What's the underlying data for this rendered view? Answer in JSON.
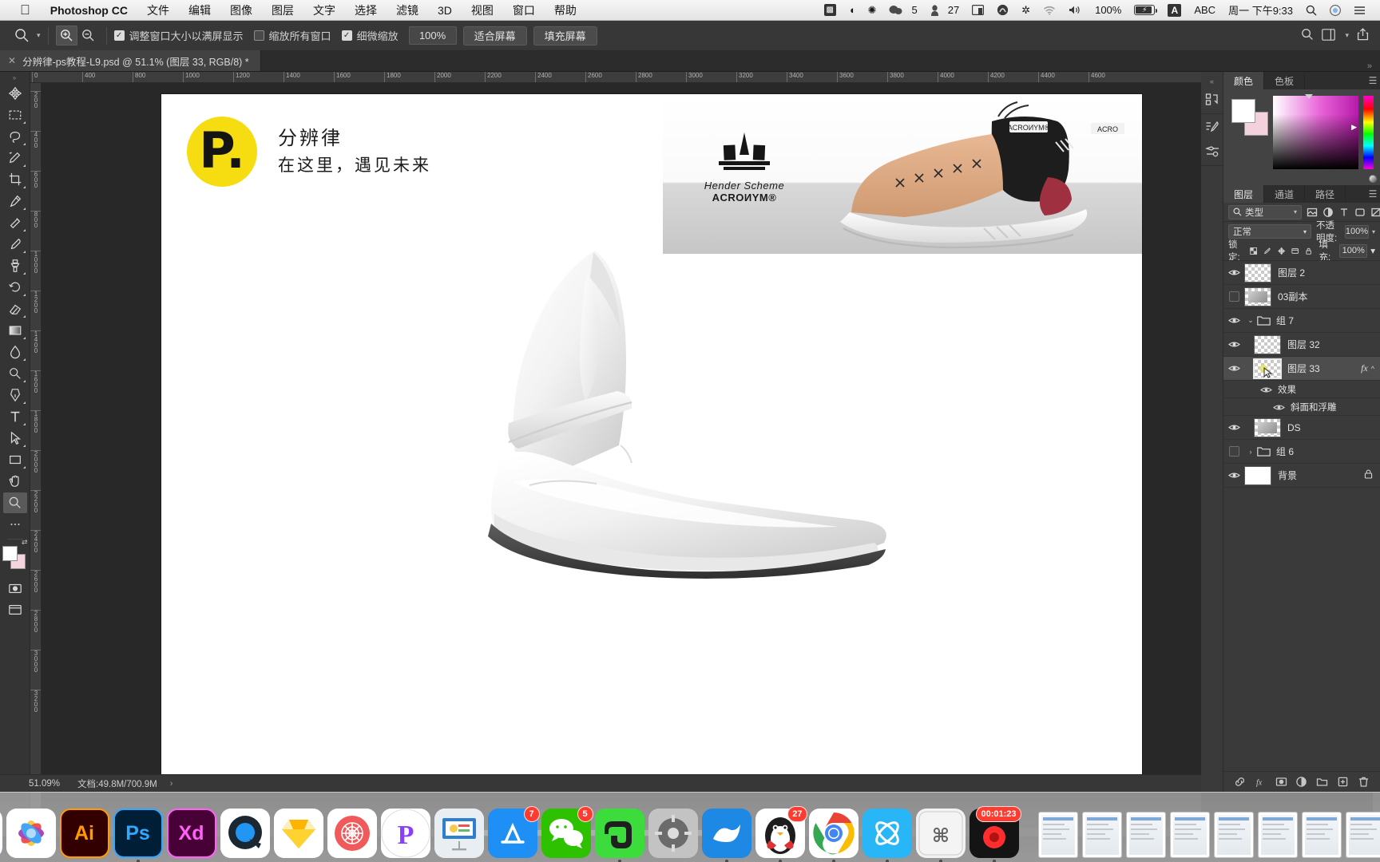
{
  "menubar": {
    "apple_icon": "apple-logo",
    "app_name": "Photoshop CC",
    "items": [
      "文件",
      "编辑",
      "图像",
      "图层",
      "文字",
      "选择",
      "滤镜",
      "3D",
      "视图",
      "窗口",
      "帮助"
    ],
    "status_items": [
      {
        "name": "screenshot-icon",
        "glyph": "▩"
      },
      {
        "name": "nightshift-icon",
        "glyph": "◗"
      },
      {
        "name": "dropbox-icon",
        "glyph": "✼"
      },
      {
        "name": "chat-icon",
        "glyph": "💬",
        "value": "5"
      },
      {
        "name": "user-icon",
        "glyph": "♟",
        "value": "27"
      },
      {
        "name": "display-icon",
        "glyph": "🖵"
      },
      {
        "name": "creativecloud-icon",
        "glyph": "◎"
      },
      {
        "name": "bluetooth-icon",
        "glyph": "✲"
      },
      {
        "name": "wifi-icon",
        "glyph": "◗"
      },
      {
        "name": "volume-icon",
        "glyph": "◀"
      }
    ],
    "battery_percent": "100%",
    "input_source_flag": "A",
    "input_source": "ABC",
    "clock": "周一 下午9:33",
    "spotlight_icon": "search-icon",
    "siri_icon": "siri-icon",
    "controlcenter_icon": "list-icon"
  },
  "optionsbar": {
    "tool_icon": "zoom-tool-icon",
    "zoom_in_icon": "zoom-in-icon",
    "zoom_out_icon": "zoom-out-icon",
    "checkboxes": [
      {
        "label": "调整窗口大小以满屏显示",
        "checked": true
      },
      {
        "label": "缩放所有窗口",
        "checked": false
      },
      {
        "label": "细微缩放",
        "checked": true
      }
    ],
    "zoom_value": "100%",
    "buttons": [
      "适合屏幕",
      "填充屏幕"
    ],
    "right_icons": [
      "search-icon",
      "workspace-icon",
      "share-icon"
    ]
  },
  "tabbar": {
    "close_icon": "close-icon",
    "title": "分辨律-ps教程-L9.psd @ 51.1% (图层 33, RGB/8) *"
  },
  "toolbar": {
    "overflow_icon": "double-chevron-icon",
    "tools": [
      {
        "name": "move-tool",
        "glyph": "move"
      },
      {
        "name": "marquee-tool",
        "glyph": "marquee"
      },
      {
        "name": "lasso-tool",
        "glyph": "lasso"
      },
      {
        "name": "quick-select-tool",
        "glyph": "wand"
      },
      {
        "name": "crop-tool",
        "glyph": "crop"
      },
      {
        "name": "eyedropper-tool",
        "glyph": "eyedropper"
      },
      {
        "name": "healing-brush-tool",
        "glyph": "heal"
      },
      {
        "name": "brush-tool",
        "glyph": "brush"
      },
      {
        "name": "clone-stamp-tool",
        "glyph": "stamp"
      },
      {
        "name": "history-brush-tool",
        "glyph": "history"
      },
      {
        "name": "eraser-tool",
        "glyph": "eraser"
      },
      {
        "name": "gradient-tool",
        "glyph": "gradient"
      },
      {
        "name": "blur-tool",
        "glyph": "blur"
      },
      {
        "name": "dodge-tool",
        "glyph": "dodge"
      },
      {
        "name": "pen-tool",
        "glyph": "pen"
      },
      {
        "name": "type-tool",
        "glyph": "T"
      },
      {
        "name": "path-select-tool",
        "glyph": "arrow"
      },
      {
        "name": "rectangle-tool",
        "glyph": "rect"
      },
      {
        "name": "hand-tool",
        "glyph": "hand"
      },
      {
        "name": "zoom-tool",
        "glyph": "zoom",
        "selected": true
      },
      {
        "name": "more-tools",
        "glyph": "dots"
      }
    ],
    "foreground_color": "#ffffff",
    "background_color": "#f4d5de",
    "quickmask_icon": "quick-mask-icon",
    "screenmode_icon": "screen-mode-icon"
  },
  "rulers": {
    "horizontal_ticks": [
      "0",
      "400",
      "800",
      "1000",
      "1200",
      "1400",
      "1600",
      "1800",
      "2000",
      "2200",
      "2400",
      "2600",
      "2800",
      "3000",
      "3200",
      "3400",
      "3600",
      "3800",
      "4000",
      "4200",
      "4400",
      "4600"
    ],
    "vertical_ticks": [
      "200",
      "400",
      "600",
      "800",
      "1000",
      "1200",
      "1400",
      "1600",
      "1800",
      "2000",
      "2200",
      "2400",
      "2600",
      "2800",
      "3000",
      "3200"
    ]
  },
  "canvas": {
    "logo_letter": "P.",
    "logo_color": "#f5dd12",
    "headline": "分辨律",
    "subline": "在这里，遇见未来",
    "banner": {
      "brand_top": "Hender Scheme",
      "brand_bottom": "ACROИYM®",
      "shoe_tag_1": "ACROИYM®",
      "shoe_tag_2": "ACRO"
    }
  },
  "statusbar": {
    "zoom": "51.09%",
    "doc_label": "文档:49.8M/700.9M",
    "arrow_icon": "chevron-right-icon"
  },
  "rightpanel": {
    "rail_icons": [
      "history-panel-icon",
      "actions-panel-icon",
      "adjustments-panel-icon"
    ],
    "collapse_icon": "double-chevron-icon",
    "color_tabs": [
      {
        "label": "颜色",
        "active": true
      },
      {
        "label": "色板",
        "active": false
      }
    ],
    "layer_tabs": [
      {
        "label": "图层",
        "active": true
      },
      {
        "label": "通道",
        "active": false
      },
      {
        "label": "路径",
        "active": false
      }
    ],
    "panel_menu_icon": "hamburger-icon",
    "filter": {
      "search_icon": "search-icon",
      "type_label": "类型",
      "caret_icon": "chevron-down-icon",
      "kind_icons": [
        "pixel-icon",
        "adjustment-icon",
        "type-icon",
        "shape-icon",
        "smart-icon"
      ],
      "toggle_on": false
    },
    "blend": {
      "mode": "正常",
      "opacity_label": "不透明度:",
      "opacity_value": "100%"
    },
    "lock": {
      "label": "锁定:",
      "icons": [
        "transparency-lock-icon",
        "brush-lock-icon",
        "move-lock-icon",
        "artboard-lock-icon",
        "all-lock-icon"
      ],
      "fill_label": "填充:",
      "fill_value": "100%"
    },
    "layers": [
      {
        "name": "图层 2",
        "visible": true,
        "type": "layer",
        "indent": 0,
        "thumb": "transparent"
      },
      {
        "name": "03副本",
        "visible": false,
        "type": "layer",
        "indent": 0,
        "thumb": "image"
      },
      {
        "name": "组 7",
        "visible": true,
        "type": "group",
        "indent": 0,
        "expanded": true
      },
      {
        "name": "图层 32",
        "visible": true,
        "type": "layer",
        "indent": 1,
        "thumb": "transparent"
      },
      {
        "name": "图层 33",
        "visible": true,
        "type": "layer",
        "indent": 1,
        "thumb": "transparent",
        "selected": true,
        "fx": "fx",
        "fx_caret": "^"
      },
      {
        "name": "效果",
        "visible": true,
        "type": "effects",
        "indent": 2
      },
      {
        "name": "斜面和浮雕",
        "visible": true,
        "type": "effect",
        "indent": 3
      },
      {
        "name": "DS",
        "visible": true,
        "type": "layer",
        "indent": 1,
        "thumb": "image"
      },
      {
        "name": "组 6",
        "visible": false,
        "type": "group",
        "indent": 0,
        "expanded": false
      },
      {
        "name": "背景",
        "visible": true,
        "type": "layer",
        "indent": 0,
        "thumb": "white",
        "locked": true,
        "lock_icon": "lock-icon"
      }
    ],
    "footer_icons": [
      "link-icon",
      "fx-icon",
      "mask-icon",
      "adjustment-icon",
      "group-icon",
      "new-layer-icon",
      "delete-icon"
    ]
  },
  "dock": {
    "apps": [
      {
        "name": "finder-alt",
        "label": "",
        "bg": "#262626",
        "fg": "#ffffff",
        "glyph": "uuu",
        "running": false
      },
      {
        "name": "finder",
        "label": "",
        "bg": "#2196f3",
        "fg": "#ffffff",
        "glyph": "finder",
        "running": true
      },
      {
        "name": "photos",
        "label": "",
        "bg": "#ffffff",
        "fg": "#ff5252",
        "glyph": "photos",
        "running": false
      },
      {
        "name": "illustrator",
        "label": "Ai",
        "bg": "#330000",
        "fg": "#ff9a00",
        "glyph": "Ai",
        "running": false
      },
      {
        "name": "photoshop",
        "label": "Ps",
        "bg": "#001e36",
        "fg": "#31a8ff",
        "glyph": "Ps",
        "running": true
      },
      {
        "name": "xd",
        "label": "Xd",
        "bg": "#470137",
        "fg": "#ff61f6",
        "glyph": "Xd",
        "running": false
      },
      {
        "name": "quicktime",
        "label": "",
        "bg": "#ffffff",
        "fg": "#1a1a1a",
        "glyph": "Q",
        "running": false
      },
      {
        "name": "sketch",
        "label": "",
        "bg": "#ffffff",
        "fg": "#fdb300",
        "glyph": "diamond",
        "running": false
      },
      {
        "name": "cinema4d",
        "label": "",
        "bg": "#ffffff",
        "fg": "#f05050",
        "glyph": "circleweb",
        "running": false
      },
      {
        "name": "principle",
        "label": "",
        "bg": "#ffffff",
        "fg": "#8a3ffc",
        "glyph": "P",
        "running": false
      },
      {
        "name": "keynote",
        "label": "",
        "bg": "#ffffff",
        "fg": "#3b9ddd",
        "glyph": "keynote",
        "running": false
      },
      {
        "name": "app-store",
        "label": "",
        "bg": "#1d8ff5",
        "fg": "#ffffff",
        "glyph": "appstore",
        "badge": "7",
        "running": false
      },
      {
        "name": "wechat",
        "label": "",
        "bg": "#2dc100",
        "fg": "#ffffff",
        "glyph": "wechat",
        "badge": "5",
        "running": false
      },
      {
        "name": "evernote",
        "label": "",
        "bg": "#3ddc3d",
        "fg": "#1a1a1a",
        "glyph": "elephant",
        "running": true
      },
      {
        "name": "system-preferences",
        "label": "",
        "bg": "#b9b9b9",
        "fg": "#3a3a3a",
        "glyph": "gear",
        "running": false
      },
      {
        "name": "browser",
        "label": "",
        "bg": "#1e88e5",
        "fg": "#ffffff",
        "glyph": "wave",
        "running": true
      },
      {
        "name": "qq",
        "label": "",
        "bg": "#ffffff",
        "fg": "#1a1a1a",
        "glyph": "penguin",
        "badge": "27",
        "running": true
      },
      {
        "name": "chrome",
        "label": "",
        "bg": "#ffffff",
        "fg": "#4285f4",
        "glyph": "chrome",
        "running": true
      },
      {
        "name": "atom",
        "label": "",
        "bg": "#29b6f6",
        "fg": "#ffffff",
        "glyph": "atom",
        "running": true
      },
      {
        "name": "keyboard-maestro",
        "label": "",
        "bg": "#f2f2f2",
        "fg": "#555555",
        "glyph": "command",
        "running": true
      },
      {
        "name": "timer",
        "label": "",
        "bg": "#1a1a1a",
        "fg": "#ff2d2d",
        "glyph": "record",
        "badge": "00:01:23",
        "running": true
      }
    ],
    "minimized_count": 9,
    "trash_icon": "trash-icon"
  }
}
